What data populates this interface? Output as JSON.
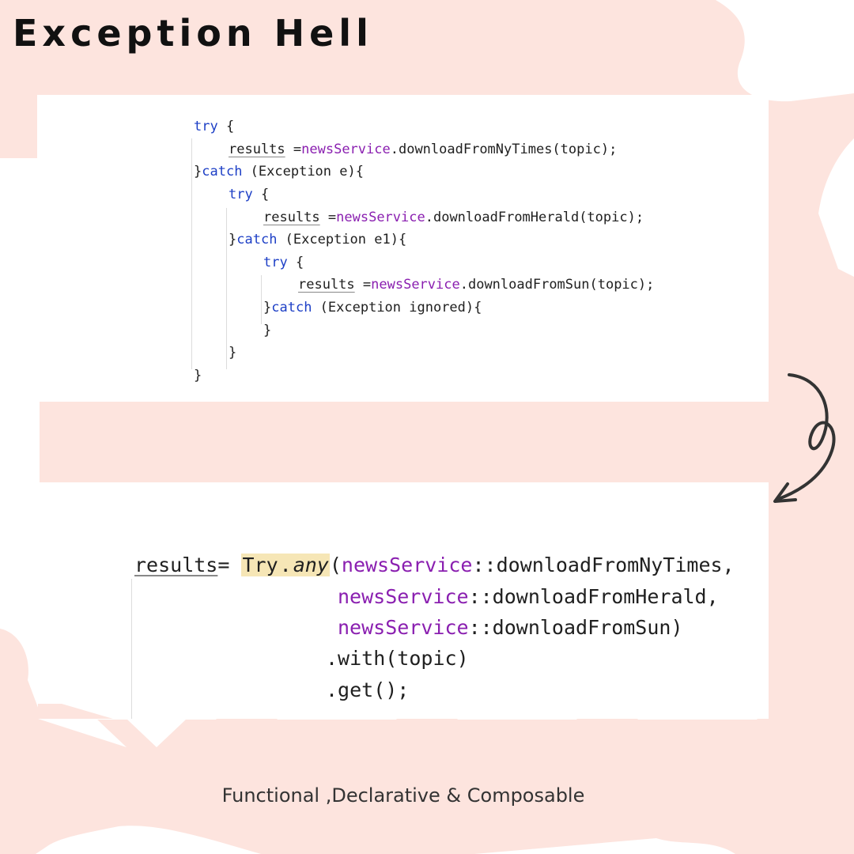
{
  "title": "Exception Hell",
  "colors": {
    "background_blob": "#fde4de",
    "keyword": "#1d3fc6",
    "service": "#8a1fb0",
    "highlight": "#f6e6b6",
    "text": "#111111"
  },
  "imperative": {
    "l1_kw": "try",
    "l1_rest": " {",
    "l2_var": "results",
    "l2_eq": " =",
    "l2_svc": "newsService",
    "l2_call": ".downloadFromNyTimes(topic);",
    "l3_brace": "}",
    "l3_kw": "catch",
    "l3_rest": " (Exception e){",
    "l4_kw": "try",
    "l4_rest": " {",
    "l5_var": "results",
    "l5_eq": " =",
    "l5_svc": "newsService",
    "l5_call": ".downloadFromHerald(topic);",
    "l6_brace": "}",
    "l6_kw": "catch",
    "l6_rest": " (Exception e1){",
    "l7_kw": "try",
    "l7_rest": " {",
    "l8_var": "results",
    "l8_eq": " =",
    "l8_svc": "newsService",
    "l8_call": ".downloadFromSun(topic);",
    "l9_brace": "}",
    "l9_kw": "catch",
    "l9_rest": " (Exception ignored){",
    "l10": "}",
    "l11": "}",
    "l12": "}"
  },
  "functional": {
    "l1_var": "results",
    "l1_eq": "= ",
    "l1_cls": "Try",
    "l1_dot": ".",
    "l1_method": "any",
    "l1_paren": "(",
    "l1_svc": "newsService",
    "l1_ref": "::downloadFromNyTimes,",
    "l2_svc": "newsService",
    "l2_ref": "::downloadFromHerald,",
    "l3_svc": "newsService",
    "l3_ref": "::downloadFromSun)",
    "l4": ".with(topic)",
    "l5": ".get();"
  },
  "caption": "Functional ,Declarative & Composable"
}
